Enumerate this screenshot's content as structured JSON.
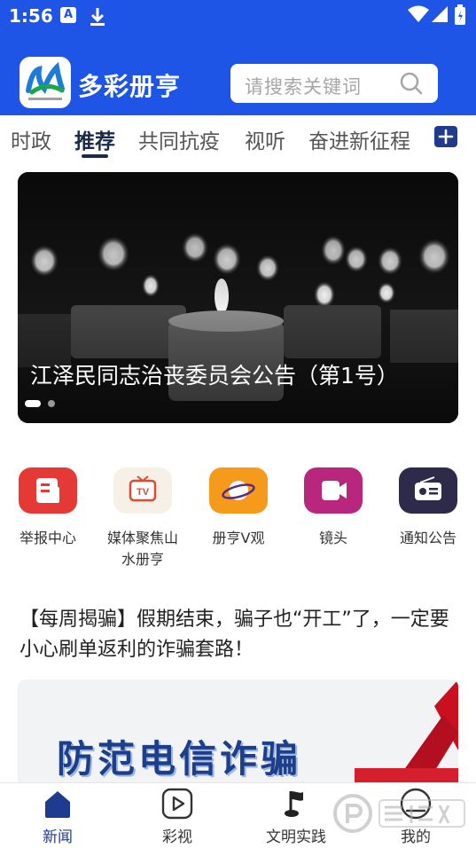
{
  "status_bar": {
    "time": "1:56",
    "notif_a": "A"
  },
  "app_bar": {
    "title": "多彩册亨",
    "search_placeholder": "请搜索关键词"
  },
  "tabs": [
    {
      "label": "时政"
    },
    {
      "label": "推荐",
      "active": true
    },
    {
      "label": "共同抗疫"
    },
    {
      "label": "视听"
    },
    {
      "label": "奋进新征程"
    }
  ],
  "banner": {
    "caption": "江泽民同志治丧委员会公告（第1号）",
    "slide_count": 2,
    "current_slide": 1
  },
  "quick_actions": [
    {
      "label": "举报中心",
      "icon": "report-icon",
      "color": "#e53935"
    },
    {
      "label": "媒体聚焦山水册亨",
      "icon": "tv-icon",
      "color": "#f7f0e6"
    },
    {
      "label": "册亨V观",
      "icon": "planet-icon",
      "color": "#f59a1b"
    },
    {
      "label": "镜头",
      "icon": "video-camera-icon",
      "color": "#b8267e"
    },
    {
      "label": "通知公告",
      "icon": "radio-icon",
      "color": "#2d2a4a"
    }
  ],
  "article": {
    "title": "【每周揭骗】假期结束，骗子也“开工”了，一定要小心刷单返利的诈骗套路！",
    "image_text": "防范电信诈骗"
  },
  "bottom_nav": [
    {
      "label": "新闻",
      "icon": "home-icon",
      "active": true
    },
    {
      "label": "彩视",
      "icon": "play-icon"
    },
    {
      "label": "文明实践",
      "icon": "flag-icon"
    },
    {
      "label": "我的",
      "icon": "user-icon"
    }
  ],
  "colors": {
    "primary": "#1f55e6",
    "active_tab": "#1a2a4a",
    "nav_active": "#1f3b8f"
  }
}
